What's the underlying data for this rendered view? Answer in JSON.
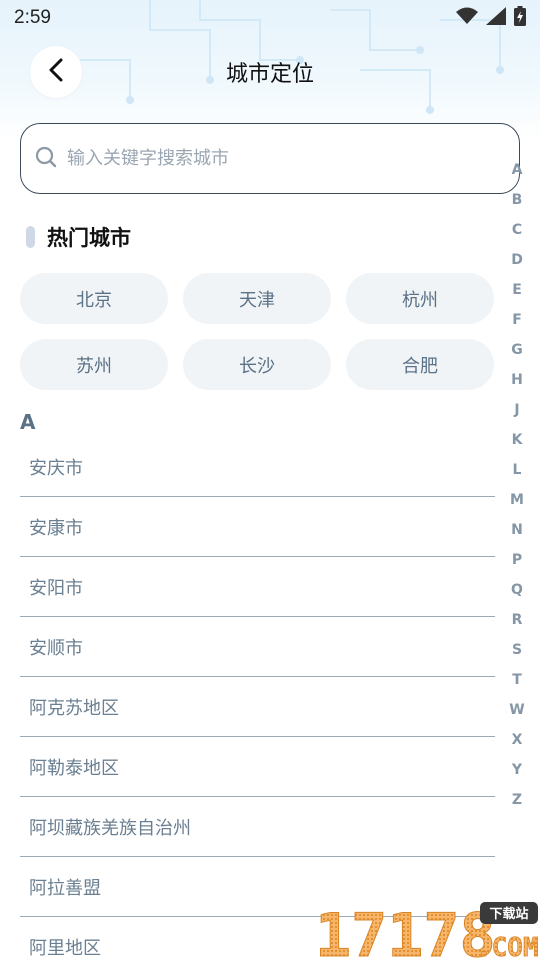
{
  "status_bar": {
    "time": "2:59",
    "icons": [
      "wifi-icon",
      "signal-icon",
      "battery-charging-icon"
    ]
  },
  "header": {
    "title": "城市定位",
    "back_icon": "chevron-left-icon"
  },
  "search": {
    "placeholder": "输入关键字搜索城市",
    "value": "",
    "icon": "search-icon"
  },
  "hot_cities": {
    "title": "热门城市",
    "items": [
      "北京",
      "天津",
      "杭州",
      "苏州",
      "长沙",
      "合肥"
    ]
  },
  "sections": [
    {
      "letter": "A",
      "cities": [
        "安庆市",
        "安康市",
        "安阳市",
        "安顺市",
        "阿克苏地区",
        "阿勒泰地区",
        "阿坝藏族羌族自治州",
        "阿拉善盟",
        "阿里地区"
      ]
    }
  ],
  "alphabet_index": [
    "A",
    "B",
    "C",
    "D",
    "E",
    "F",
    "G",
    "H",
    "J",
    "K",
    "L",
    "M",
    "N",
    "P",
    "Q",
    "R",
    "S",
    "T",
    "W",
    "X",
    "Y",
    "Z"
  ],
  "watermark": {
    "number": "17178",
    "tag": "下载站",
    "suffix": ".COM"
  },
  "colors": {
    "chip_bg": "#f1f4f7",
    "chip_text": "#5a7186",
    "list_text": "#6a7f91",
    "index_text": "#8596a6",
    "divider": "#9aaab6",
    "watermark_orange": "#f1a24a"
  }
}
